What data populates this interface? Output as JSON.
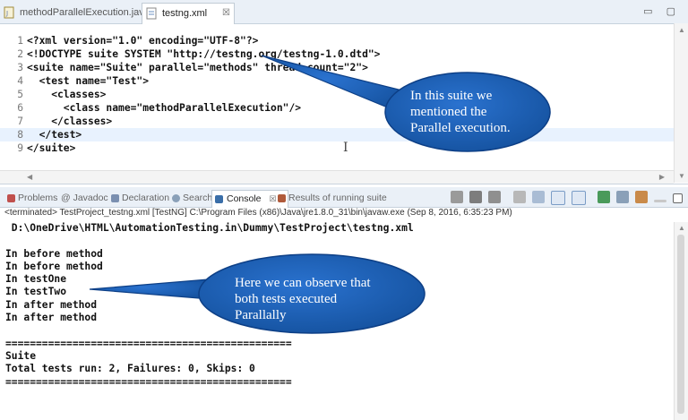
{
  "editor": {
    "tabs": [
      {
        "label": "methodParallelExecution.java"
      },
      {
        "label": "testng.xml",
        "close": "☒"
      }
    ],
    "window_controls": "▭ ▢",
    "lines": [
      {
        "num": "1",
        "text": "<?xml version=\"1.0\" encoding=\"UTF-8\"?>"
      },
      {
        "num": "2",
        "text": "<!DOCTYPE suite SYSTEM \"http://testng.org/testng-1.0.dtd\">"
      },
      {
        "num": "3",
        "text": "<suite name=\"Suite\" parallel=\"methods\" thread-count=\"2\">"
      },
      {
        "num": "4",
        "text": "  <test name=\"Test\">"
      },
      {
        "num": "5",
        "text": "    <classes>"
      },
      {
        "num": "6",
        "text": "      <class name=\"methodParallelExecution\"/>"
      },
      {
        "num": "7",
        "text": "    </classes>"
      },
      {
        "num": "8",
        "text": "  </test>"
      },
      {
        "num": "9",
        "text": "</suite>"
      }
    ]
  },
  "console": {
    "tabs": [
      {
        "label": "Problems",
        "color": "#c0504d"
      },
      {
        "label": "@ Javadoc",
        "color": "#ffffff"
      },
      {
        "label": "Declaration",
        "color": "#7a8fb0"
      },
      {
        "label": "Search",
        "color": "#8aa0b8"
      },
      {
        "label": "Console",
        "color": "#3a6ea8",
        "close": "☒"
      },
      {
        "label": "Results of running suite",
        "color": "#b05a3a"
      }
    ],
    "status": "<terminated> TestProject_testng.xml [TestNG] C:\\Program Files (x86)\\Java\\jre1.8.0_31\\bin\\javaw.exe (Sep 8, 2016, 6:35:23 PM)",
    "output": [
      " D:\\OneDrive\\HTML\\AutomationTesting.in\\Dummy\\TestProject\\testng.xml",
      "",
      "In before method",
      "In before method",
      "In testOne",
      "In testTwo",
      "In after method",
      "In after method",
      "",
      "===============================================",
      "Suite",
      "Total tests run: 2, Failures: 0, Skips: 0",
      "==============================================="
    ]
  },
  "callouts": [
    {
      "lines": [
        "In this suite we",
        "mentioned the",
        "Parallel execution."
      ]
    },
    {
      "lines": [
        "Here we can observe that",
        "both tests executed",
        "Parallally"
      ]
    }
  ],
  "colors": {
    "callout_fill": "#1f5fb8",
    "callout_edge": "#0d3f86",
    "line_highlight": "#e8f2fe",
    "panel_tabbar": "#eaf0f7"
  }
}
